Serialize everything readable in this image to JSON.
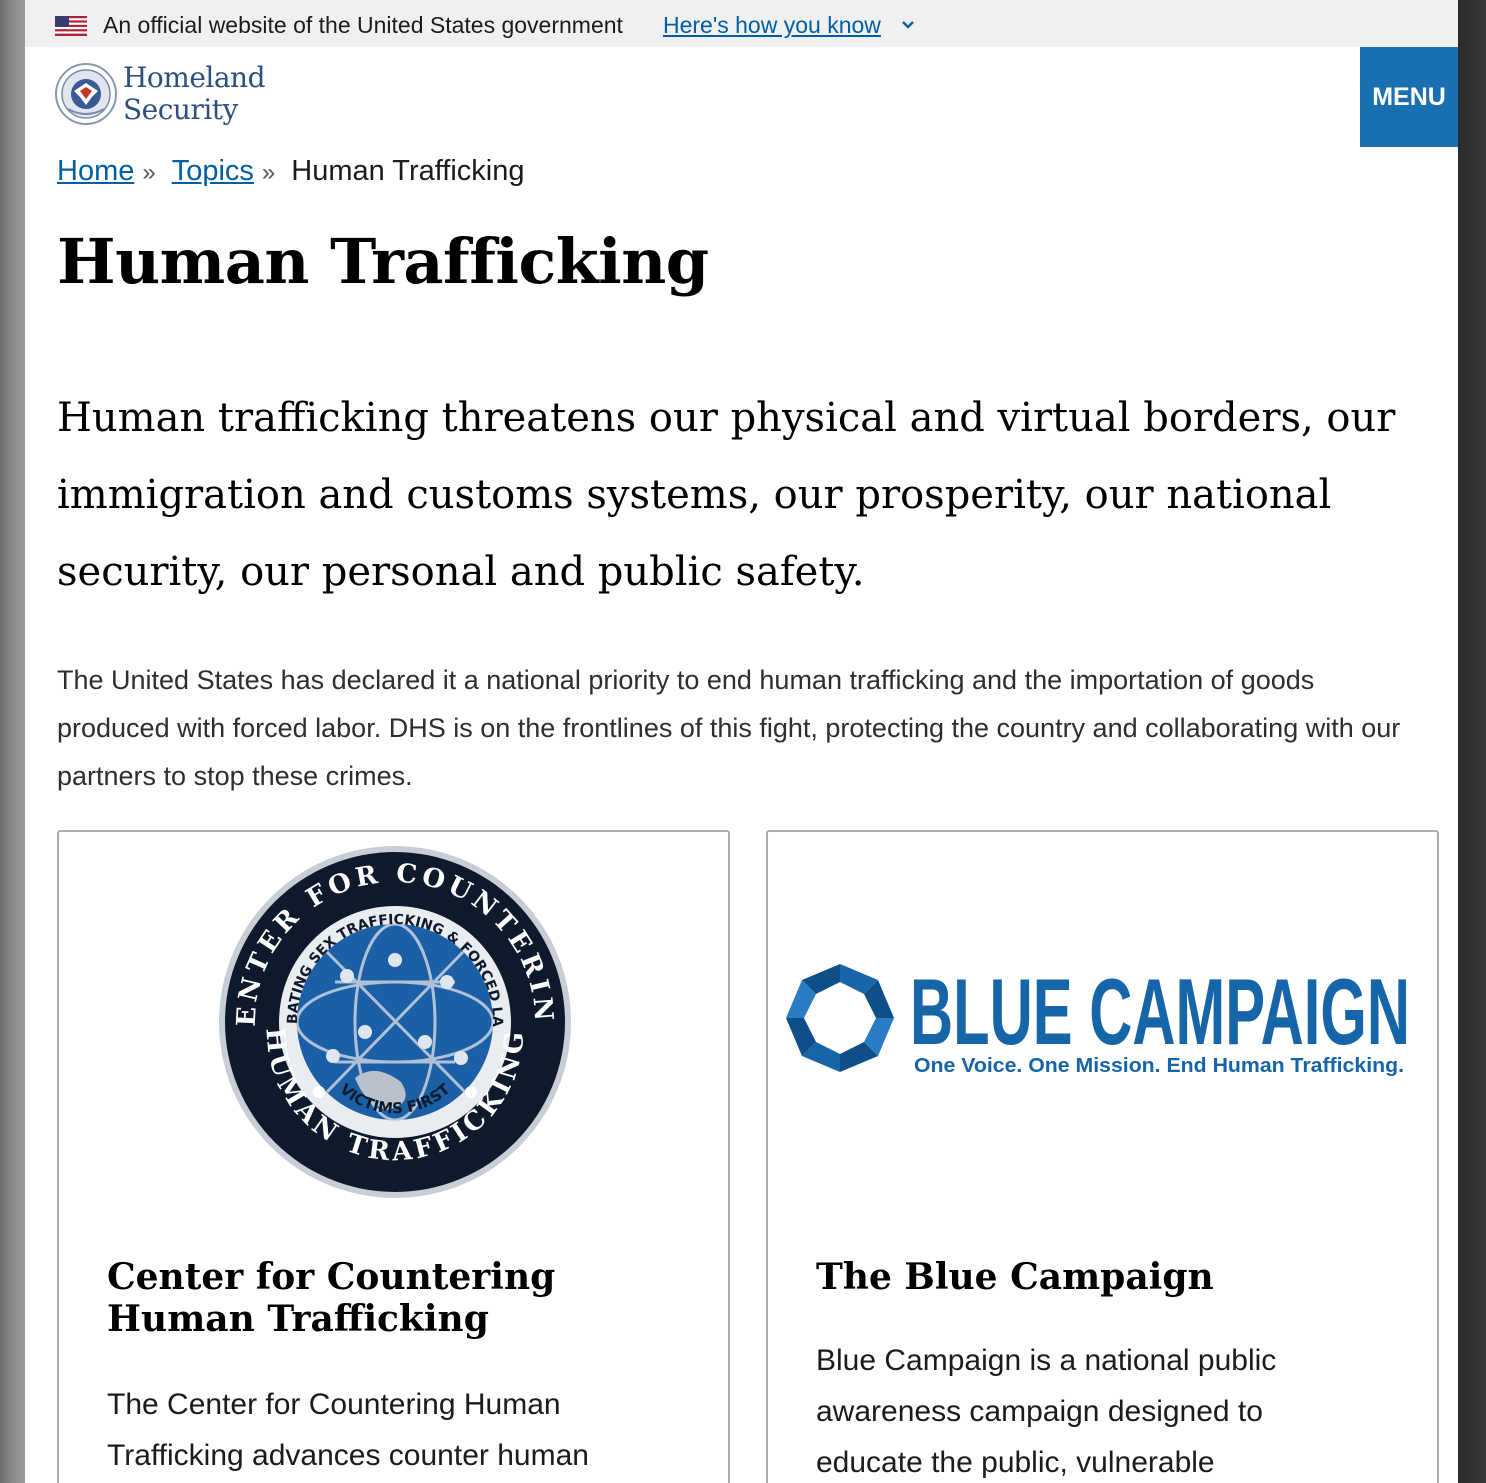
{
  "banner": {
    "text": "An official website of the United States government",
    "link": "Here's how you know"
  },
  "header": {
    "logo_line1": "Homeland",
    "logo_line2": "Security",
    "menu": "MENU"
  },
  "breadcrumb": {
    "home": "Home",
    "topics": "Topics",
    "separator": "»",
    "current": "Human Trafficking"
  },
  "page": {
    "title": "Human Trafficking",
    "lead": "Human trafficking threatens our physical and virtual borders, our immigration and customs systems, our prosperity, our national security, our personal and public safety.",
    "intro": "The United States has declared it a national priority to end human trafficking and the importation of goods produced with forced labor. DHS is on the frontlines of this fight, protecting the country and collaborating with our partners to stop these crimes."
  },
  "cards": [
    {
      "title": "Center for Countering Human Trafficking",
      "text": "The Center for Countering Human Trafficking advances counter human",
      "seal_ring_top": "CENTER FOR COUNTERING",
      "seal_ring_bottom": "HUMAN TRAFFICKING",
      "seal_inner_ring": "COMBATING SEX TRAFFICKING & FORCED LABOR",
      "seal_motto": "VICTIMS FIRST"
    },
    {
      "title": "The Blue Campaign",
      "text": "Blue Campaign is a national public awareness campaign designed to educate the public, vulnerable",
      "logo_word": "BLUE CAMPAIGN",
      "logo_tagline": "One Voice. One Mission. End Human Trafficking."
    }
  ],
  "colors": {
    "link": "#005ea2",
    "menu_bg": "#1a6fb0",
    "banner_bg": "#f0f0f0",
    "blue_campaign": "#1565a8"
  }
}
